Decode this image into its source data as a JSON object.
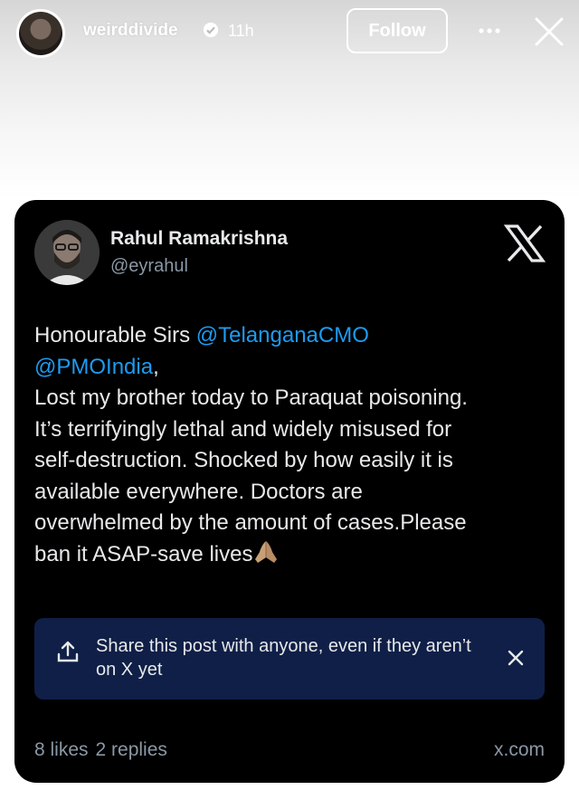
{
  "story_header": {
    "username": "weirddivide",
    "time": "11h",
    "follow_label": "Follow",
    "icons": [
      "verified-icon",
      "more-icon",
      "close-icon"
    ]
  },
  "post": {
    "author_name": "Rahul Ramakrishna",
    "author_handle": "@eyrahul",
    "platform_logo": "x-logo",
    "text": {
      "greeting": "Honourable Sirs ",
      "mention_1": "@TelanganaCMO",
      "mention_2": "@PMOIndia",
      "after_mentions": ",",
      "body": "Lost my brother today to Paraquat poisoning.\nIt’s terrifyingly lethal and widely misused for\nself-destruction. Shocked by how easily it is\navailable everywhere. Doctors are\noverwhelmed by the amount of cases.Please\nban it ASAP-save lives",
      "emoji": "folded-hands-emoji"
    },
    "share_banner": {
      "text": "Share this post with anyone, even if they aren’t on X yet",
      "icon": "share-icon",
      "dismiss_icon": "close-icon"
    },
    "stats": {
      "likes": "8 likes",
      "replies": "2 replies"
    },
    "source": "x.com"
  },
  "colors": {
    "card_bg": "#000000",
    "mention": "#1d9bf0",
    "banner_bg": "#0f1f47",
    "muted": "#8b98a5"
  }
}
